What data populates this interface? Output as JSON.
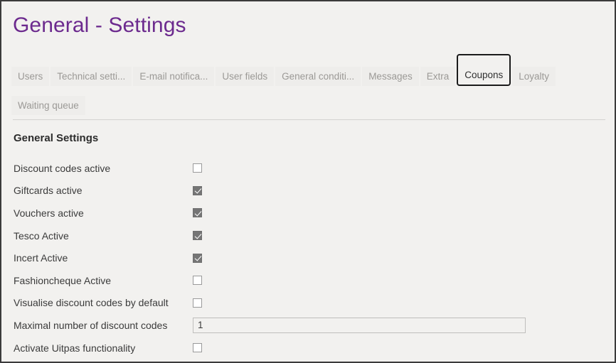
{
  "window": {
    "title": "General - Settings",
    "accent_color": "#6c2a8e",
    "background_color": "#f2f1ef",
    "border_color": "#3b3b3b"
  },
  "tabs": {
    "rows": [
      [
        {
          "label": "Users",
          "selected": false
        },
        {
          "label": "Technical setti...",
          "selected": false
        },
        {
          "label": "E-mail notifica...",
          "selected": false
        },
        {
          "label": "User fields",
          "selected": false
        },
        {
          "label": "General conditi...",
          "selected": false
        },
        {
          "label": "Messages",
          "selected": false
        },
        {
          "label": "Extra",
          "selected": false
        },
        {
          "label": "Coupons",
          "selected": true
        },
        {
          "label": "Loyalty",
          "selected": false
        }
      ],
      [
        {
          "label": "Waiting queue",
          "selected": false
        }
      ]
    ]
  },
  "main": {
    "section_title": "General Settings",
    "settings": [
      {
        "label": "Discount codes active",
        "type": "checkbox",
        "checked": false
      },
      {
        "label": "Giftcards active",
        "type": "checkbox",
        "checked": true
      },
      {
        "label": "Vouchers active",
        "type": "checkbox",
        "checked": true
      },
      {
        "label": "Tesco Active",
        "type": "checkbox",
        "checked": true
      },
      {
        "label": "Incert Active",
        "type": "checkbox",
        "checked": true
      },
      {
        "label": "Fashioncheque Active",
        "type": "checkbox",
        "checked": false
      },
      {
        "label": "Visualise discount codes by default",
        "type": "checkbox",
        "checked": false
      },
      {
        "label": "Maximal number of discount codes",
        "type": "text",
        "value": "1",
        "placeholder": ""
      },
      {
        "label": "Activate Uitpas functionality",
        "type": "checkbox",
        "checked": false
      }
    ]
  }
}
